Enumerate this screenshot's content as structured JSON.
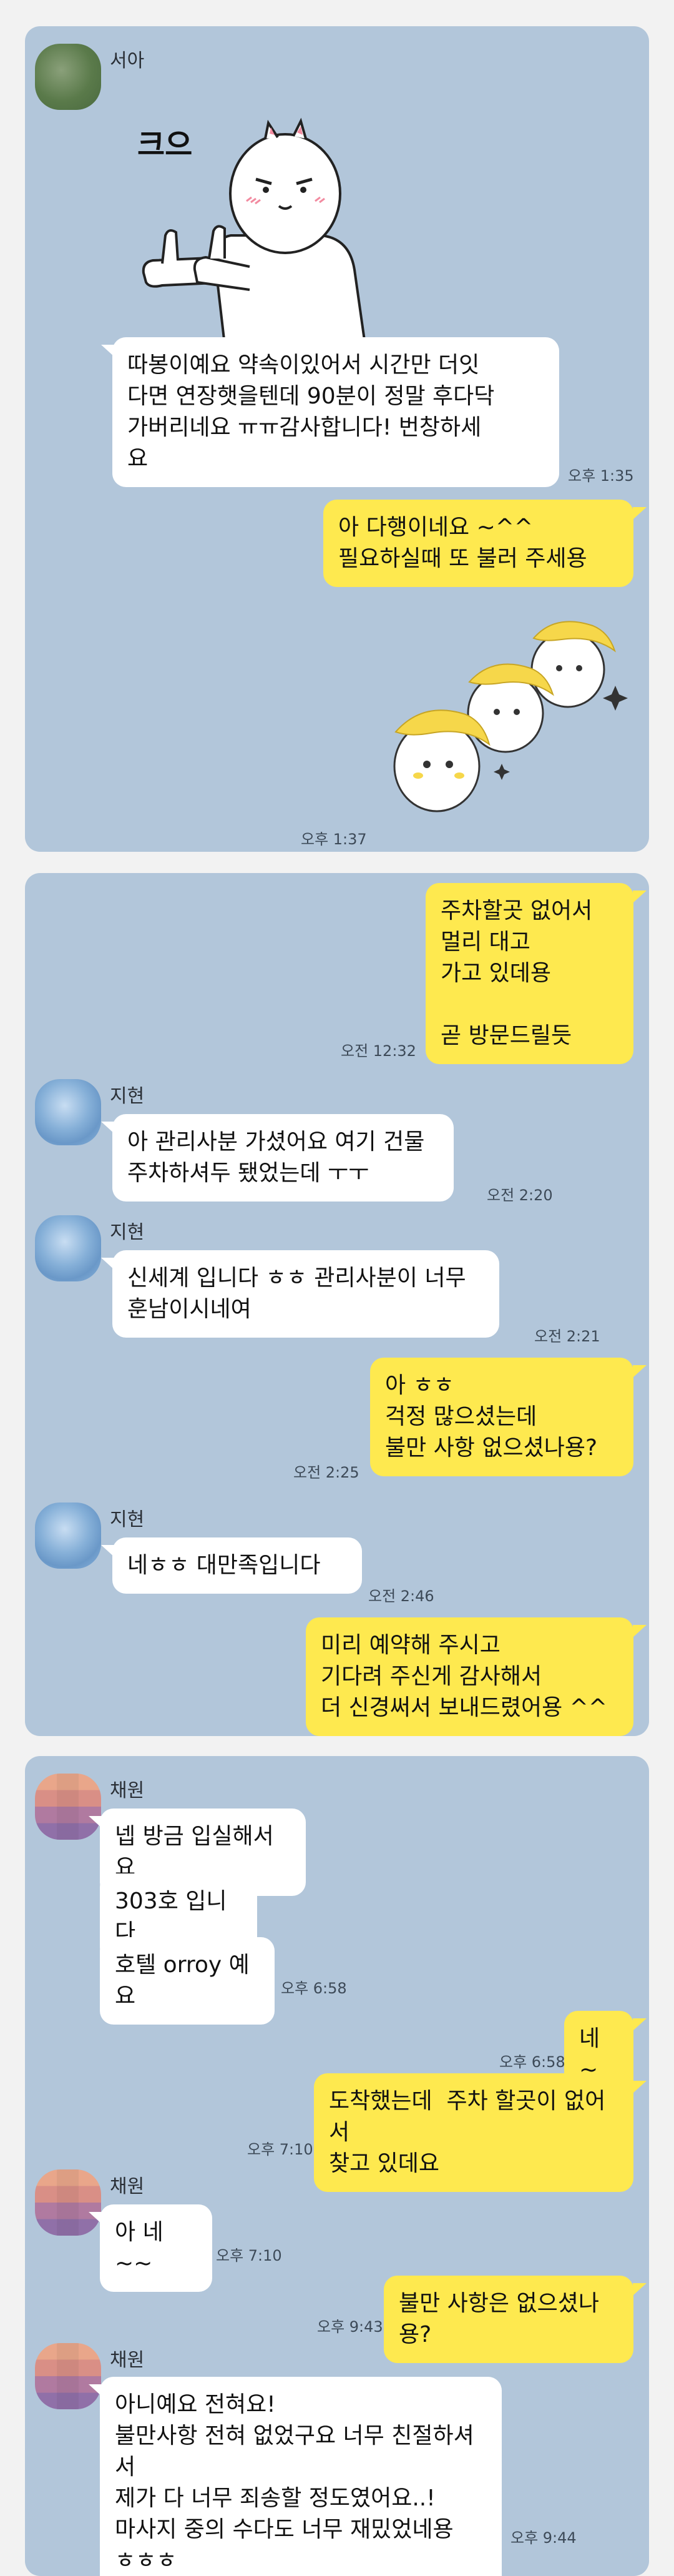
{
  "section1": {
    "sender": "서아",
    "sticker_caption": "크으",
    "msg1": "따봉이예요 약속이있어서 시간만 더잇\n다면 연장햇을텐데 90분이 정말 후다닥\n가버리네요 ㅠㅠ감사합니다! 번창하세\n요",
    "time1": "오후 1:35",
    "reply": "아 다행이네요 ~^^\n필요하실때 또 불러 주세용",
    "time2": "오후 1:37"
  },
  "section2": {
    "out1": "주차할곳 없어서\n멀리 대고\n가고 있데용\n\n곧 방문드릴듯",
    "out1_time": "오전 12:32",
    "sender": "지현",
    "in1": "아 관리사분 가셨어요 여기 건물\n주차하셔두 됐었는데 ㅜㅜ",
    "in1_time": "오전 2:20",
    "in2": "신세계 입니다 ㅎㅎ 관리사분이 너무\n훈남이시네여",
    "in2_time": "오전 2:21",
    "out2": "아 ㅎㅎ\n걱정 많으셨는데\n불만 사항 없으셨나용?",
    "out2_time": "오전 2:25",
    "in3": "네ㅎㅎ 대만족입니다",
    "in3_time": "오전 2:46",
    "out3": "미리 예약해 주시고\n기다려 주신게 감사해서\n더 신경써서 보내드렸어용 ^^"
  },
  "section3": {
    "sender": "채원",
    "in1": "넵 방금 입실해서요",
    "in2": "303호 입니다",
    "in3": "호텔 orroy 예요",
    "in3_time": "오후 6:58",
    "out1": "네 ~",
    "out1_time": "오후 6:58",
    "out2": "도착했는데  주차 할곳이 없어서\n찾고 있데요",
    "out2_time": "오후 7:10",
    "in4": "아 네~~",
    "in4_time": "오후 7:10",
    "out3": "불만 사항은 없으셨나용?",
    "out3_time": "오후 9:43",
    "in5": "아니예요 전혀요!\n불만사항 전혀 없었구요 너무 친절하셔서\n제가 다 너무 죄송할 정도였어요..!\n마사지 중의 수다도 너무 재밌었네용\nㅎㅎㅎ",
    "in5_time": "오후 9:44"
  },
  "colors": {
    "background": "#b2c6da",
    "bubble_mine": "#fee94f",
    "bubble_theirs": "#ffffff"
  }
}
